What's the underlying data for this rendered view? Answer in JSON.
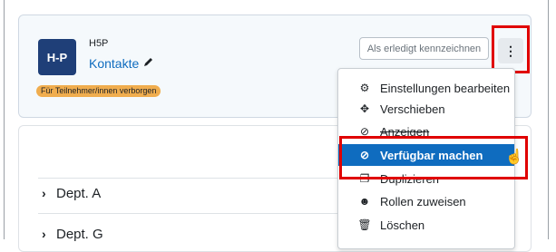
{
  "activity": {
    "logo_text": "H-P",
    "type_label": "H5P",
    "name": "Kontakte",
    "badge": "Für Teilnehmer/innen verborgen",
    "done_button": "Als erledigt kennzeichnen"
  },
  "content": {
    "depts": [
      "Dept. A",
      "Dept. G"
    ]
  },
  "menu": {
    "items": [
      {
        "label": "Einstellungen bearbeiten",
        "icon": "gear-icon"
      },
      {
        "label": "Verschieben",
        "icon": "move-arrows-icon"
      },
      {
        "label": "Anzeigen",
        "icon": "eye-slash-icon"
      },
      {
        "label": "Verfügbar machen",
        "icon": "ban-icon"
      },
      {
        "label": "Duplizieren",
        "icon": "copy-icon"
      },
      {
        "label": "Rollen zuweisen",
        "icon": "user-circle-icon"
      },
      {
        "label": "Löschen",
        "icon": "trash-icon"
      }
    ]
  },
  "colors": {
    "accent": "#0f6cbf",
    "highlight": "#e00000",
    "badge": "#f0ad4e",
    "logo_bg": "#1f3f78"
  }
}
